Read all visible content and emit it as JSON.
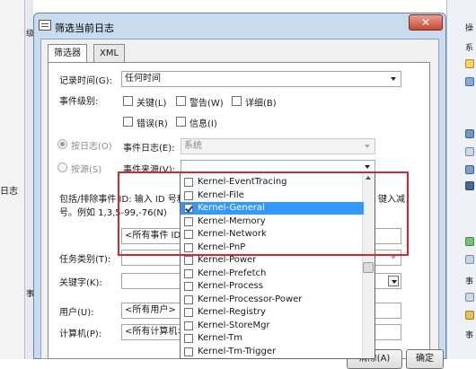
{
  "background": {
    "left_text": "日志",
    "strip_chars": [
      "级",
      "事"
    ],
    "right_labels": [
      "操",
      "系",
      "事",
      "事"
    ]
  },
  "dialog": {
    "title": "筛选当前日志",
    "close_label": "✕",
    "tabs": [
      "筛选器",
      "XML"
    ]
  },
  "form": {
    "logged_label": "记录时间(G):",
    "logged_value": "任何时间",
    "event_level_label": "事件级别:",
    "levels": [
      "关键(L)",
      "警告(W)",
      "详细(B)",
      "错误(R)",
      "信息(I)"
    ],
    "by_log_label": "按日志(O)",
    "by_source_label": "按源(S)",
    "event_logs_label": "事件日志(E):",
    "event_logs_value": "系统",
    "event_sources_label": "事件来源(V):",
    "event_sources_value": "",
    "include_exclude_text_1": "包括/排除事件 ID: 输入 ID 号和",
    "include_exclude_text_2": "号。例如 1,3,5-99,-76(N)",
    "include_exclude_tail": "键入减",
    "event_ids_value": "<所有事件 ID>",
    "task_category_label": "任务类别(T):",
    "keywords_label": "关键字(K):",
    "user_label": "用户(U):",
    "user_value": "<所有用户>",
    "computer_label": "计算机(P):",
    "computer_value": "<所有计算机>",
    "clear_button": "清除(A)",
    "ok_button": "确定"
  },
  "source_list": [
    {
      "label": "Kernel-EventTracing",
      "checked": false
    },
    {
      "label": "Kernel-File",
      "checked": false
    },
    {
      "label": "Kernel-General",
      "checked": true,
      "selected": true
    },
    {
      "label": "Kernel-Memory",
      "checked": false
    },
    {
      "label": "Kernel-Network",
      "checked": false
    },
    {
      "label": "Kernel-PnP",
      "checked": false
    },
    {
      "label": "Kernel-Power",
      "checked": false
    },
    {
      "label": "Kernel-Prefetch",
      "checked": false
    },
    {
      "label": "Kernel-Process",
      "checked": false
    },
    {
      "label": "Kernel-Processor-Power",
      "checked": false
    },
    {
      "label": "Kernel-Registry",
      "checked": false
    },
    {
      "label": "Kernel-StoreMgr",
      "checked": false
    },
    {
      "label": "Kernel-Tm",
      "checked": false
    },
    {
      "label": "Kernel-Tm-Trigger",
      "checked": false
    }
  ],
  "colors": {
    "highlight_box": "#d9262b",
    "selection": "#3399ff",
    "title_bar": "#c9dbef",
    "close_button": "#c54a34"
  }
}
